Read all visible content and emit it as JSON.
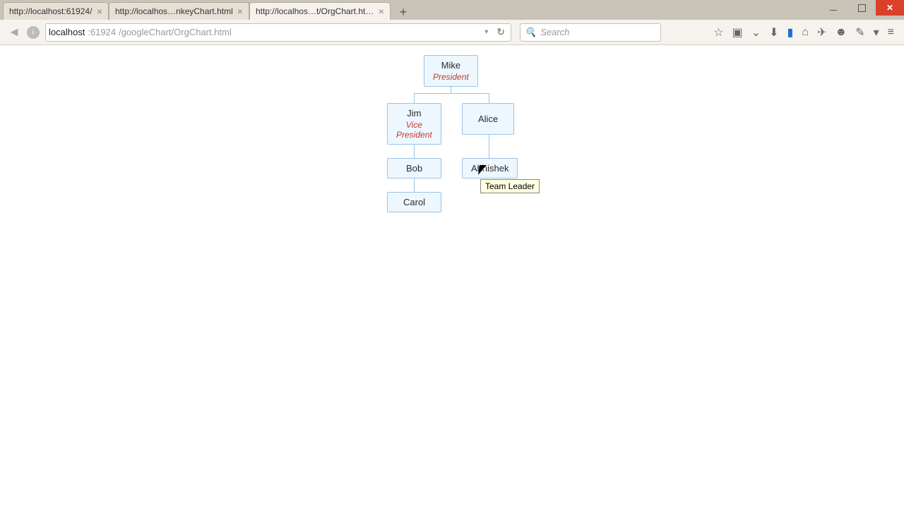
{
  "window": {
    "minimize_label": "Minimize",
    "maximize_label": "Maximize",
    "close_label": "Close"
  },
  "tabs": [
    {
      "label": "http://localhost:61924/"
    },
    {
      "label": "http://localhos…nkeyChart.html"
    },
    {
      "label": "http://localhos…t/OrgChart.html"
    }
  ],
  "active_tab_index": 2,
  "new_tab_label": "+",
  "nav": {
    "back_label": "◄",
    "url_host": "localhost",
    "url_port": ":61924",
    "url_path": "/googleChart/OrgChart.html",
    "reload_label": "↻",
    "search_placeholder": "Search"
  },
  "toolbar": {
    "bookmark": "☆",
    "library": "▣",
    "pocket": "⌄",
    "downloads": "⬇",
    "screenshot": "▮",
    "home": "⌂",
    "send": "✈",
    "chat": "☻",
    "brush": "✎",
    "dropdown": "▾",
    "menu": "≡"
  },
  "org": {
    "nodes": {
      "mike": {
        "name": "Mike",
        "title": "President"
      },
      "jim": {
        "name": "Jim",
        "title": "Vice President"
      },
      "alice": {
        "name": "Alice",
        "title": ""
      },
      "bob": {
        "name": "Bob",
        "title": ""
      },
      "abhishek": {
        "name": "Abhishek",
        "title": ""
      },
      "carol": {
        "name": "Carol",
        "title": ""
      }
    },
    "tooltip": "Team Leader"
  },
  "chart_data": {
    "type": "orgchart",
    "rows": [
      {
        "id": "Mike",
        "parent": "",
        "title": "President",
        "tooltip": ""
      },
      {
        "id": "Jim",
        "parent": "Mike",
        "title": "Vice President",
        "tooltip": ""
      },
      {
        "id": "Alice",
        "parent": "Mike",
        "title": "",
        "tooltip": ""
      },
      {
        "id": "Bob",
        "parent": "Jim",
        "title": "",
        "tooltip": ""
      },
      {
        "id": "Carol",
        "parent": "Bob",
        "title": "",
        "tooltip": ""
      },
      {
        "id": "Abhishek",
        "parent": "Alice",
        "title": "",
        "tooltip": "Team Leader"
      }
    ]
  }
}
